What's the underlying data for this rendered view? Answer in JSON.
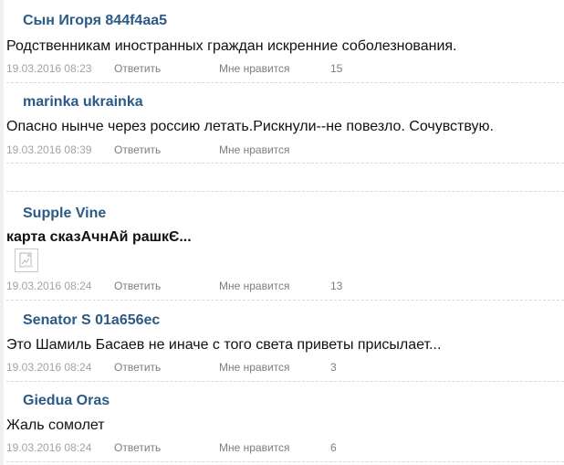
{
  "comments": [
    {
      "author": "Сын Игоря 844f4aa5",
      "text": "Родственникам иностранных граждан искренние соболезнования.",
      "date": "19.03.2016 08:23",
      "reply": "Ответить",
      "like": "Мне нравится",
      "likes": "15"
    },
    {
      "author": "marinka ukrainka",
      "text": "Опасно нынче через россию летать.Рискнули--не повезло. Сочувствую.",
      "date": "19.03.2016 08:39",
      "reply": "Ответить",
      "like": "Мне нравится",
      "likes": ""
    },
    {
      "author": "Supple Vine",
      "text": "карта сказАчнАй рашкЄ...",
      "image_icon": "image-placeholder-icon",
      "date": "19.03.2016 08:24",
      "reply": "Ответить",
      "like": "Мне нравится",
      "likes": "13"
    },
    {
      "author": "Senator S 01a656ec",
      "text": "Это Шамиль Басаев не иначе с того света приветы присылает...",
      "date": "19.03.2016 08:24",
      "reply": "Ответить",
      "like": "Мне нравится",
      "likes": "3"
    },
    {
      "author": "Giedua Oras",
      "text": "Жаль сомолет",
      "date": "19.03.2016 08:24",
      "reply": "Ответить",
      "like": "Мне нравится",
      "likes": "6"
    }
  ],
  "colors": {
    "author": "#2b5a86",
    "text": "#111111",
    "meta": "#8a8a8a",
    "separator": "#d9d9d9"
  }
}
